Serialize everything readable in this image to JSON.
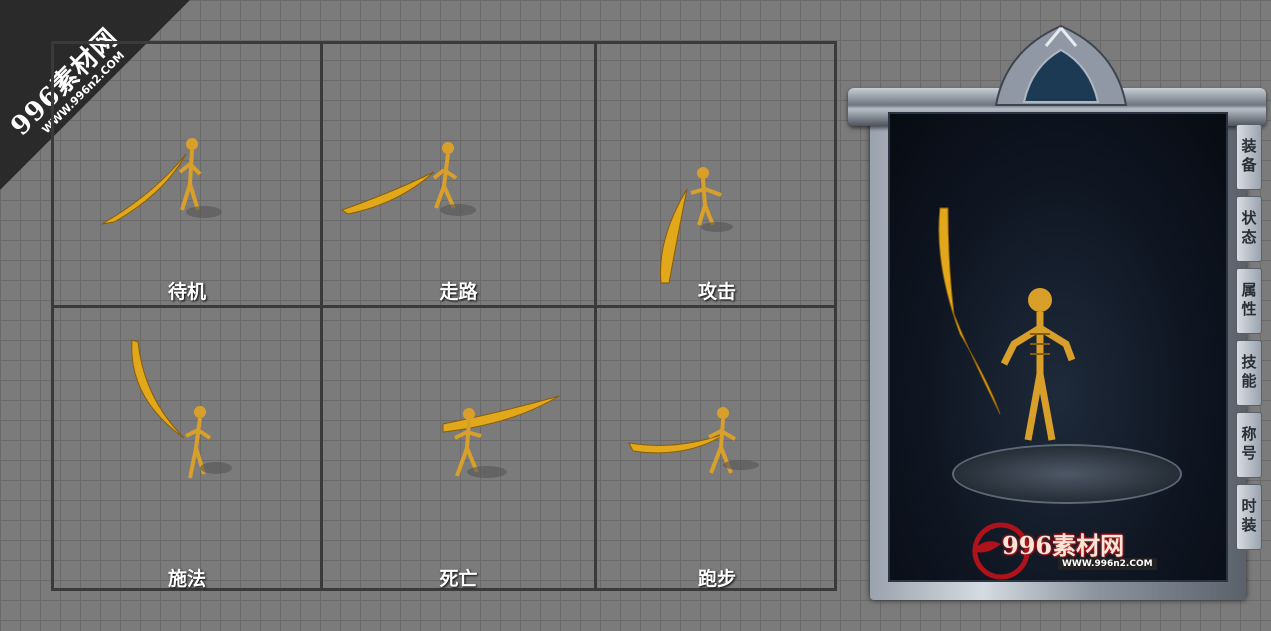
{
  "watermark": {
    "brand": "996素材网",
    "url": "WWW.996n2.COM"
  },
  "frames": [
    {
      "id": "idle",
      "label": "待机"
    },
    {
      "id": "walk",
      "label": "走路"
    },
    {
      "id": "attack",
      "label": "攻击"
    },
    {
      "id": "cast",
      "label": "施法"
    },
    {
      "id": "death",
      "label": "死亡"
    },
    {
      "id": "run",
      "label": "跑步"
    }
  ],
  "panel": {
    "tabs": [
      "装备",
      "状态",
      "属性",
      "技能",
      "称号",
      "时装"
    ],
    "logo_main": "996素材网",
    "logo_sub": "WWW.996n2.COM"
  },
  "colors": {
    "gold": "#e0a81a",
    "bone": "#d8a02a",
    "panel_bg": "#0f1622"
  }
}
